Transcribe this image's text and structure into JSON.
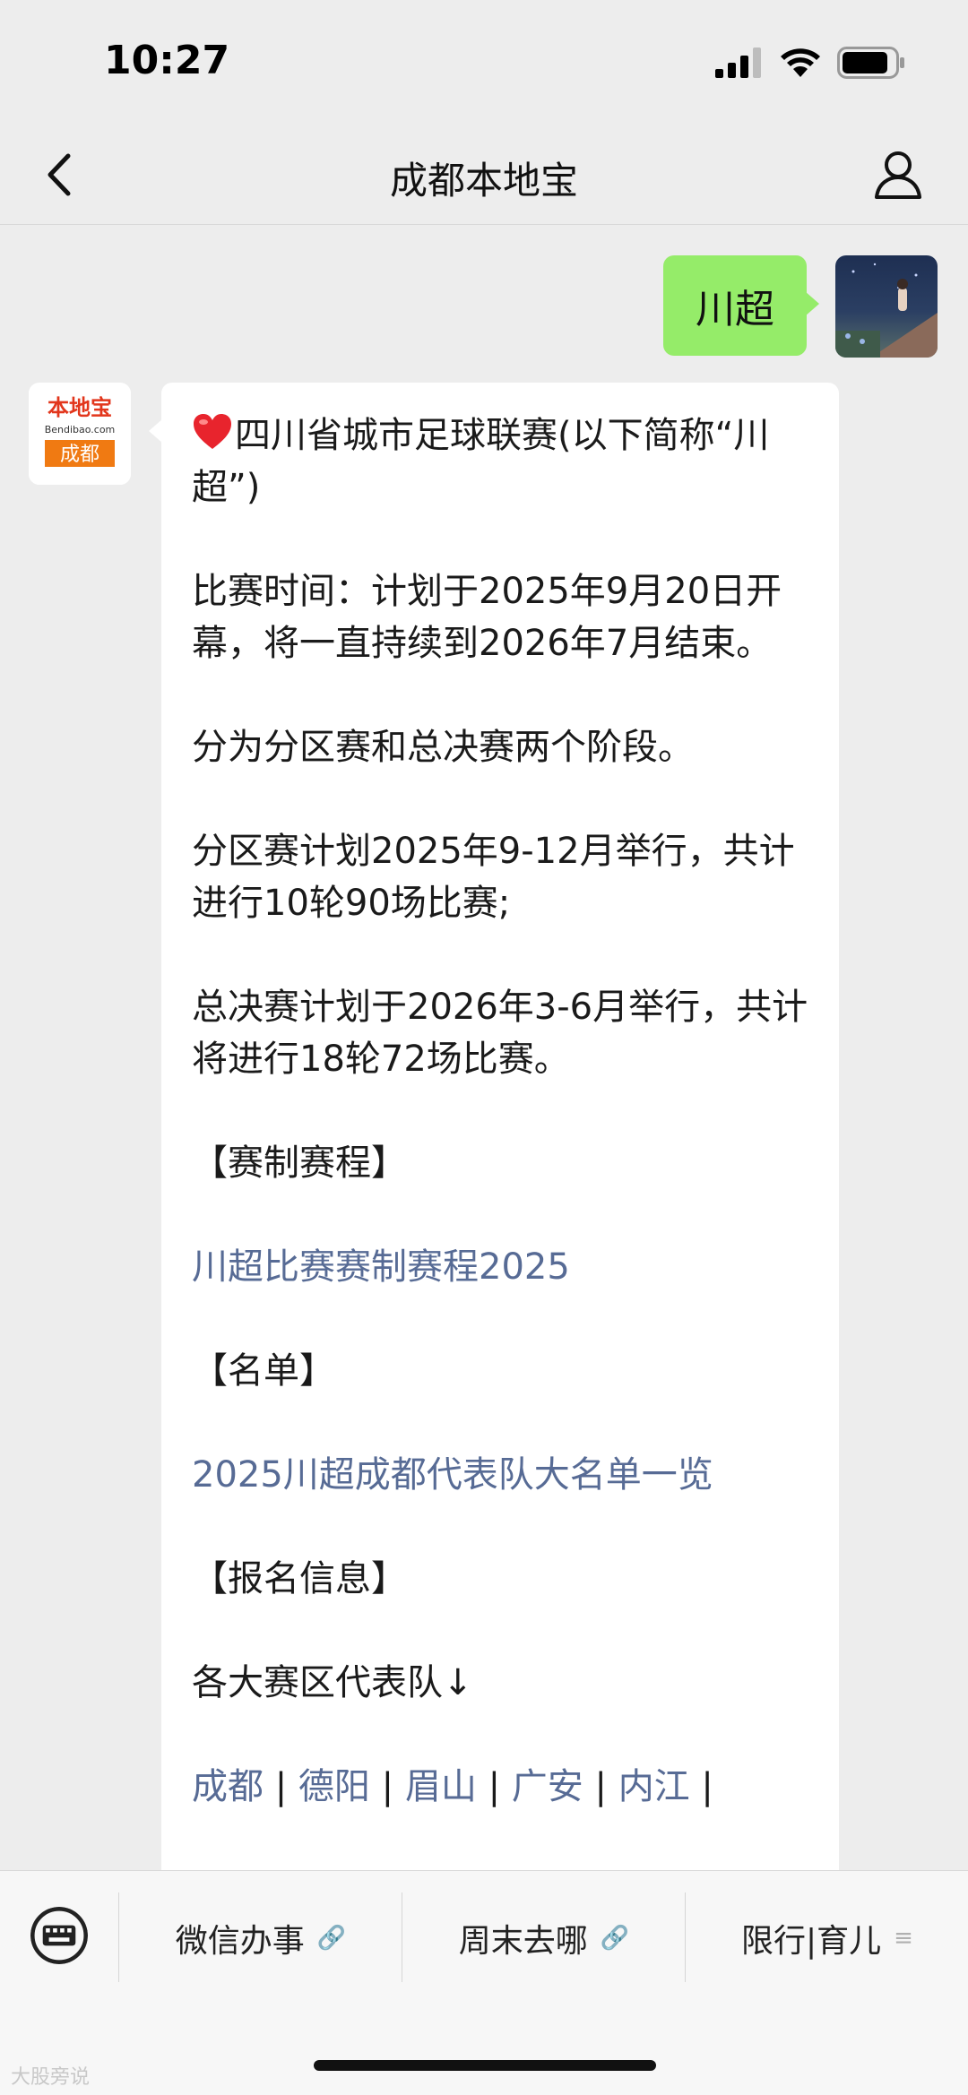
{
  "status": {
    "time": "10:27"
  },
  "nav": {
    "title": "成都本地宝"
  },
  "user_message": "川超",
  "bot": {
    "logo_top": "本地宝",
    "logo_site": "Bendibao.com",
    "logo_city": "成都",
    "intro": "四川省城市足球联赛(以下简称“川超”)",
    "time_text": "比赛时间：计划于2025年9月20日开幕，将一直持续到2026年7月结束。",
    "stages": "分为分区赛和总决赛两个阶段。",
    "division": "分区赛计划2025年9-12月举行，共计进行10轮90场比赛;",
    "finals": "总决赛计划于2026年3-6月举行，共计将进行18轮72场比赛。",
    "section_schedule": "【赛制赛程】",
    "link_schedule": "川超比赛赛制赛程2025",
    "section_roster": "【名单】",
    "link_roster": "2025川超成都代表队大名单一览",
    "section_signup": "【报名信息】",
    "teams_label": "各大赛区代表队↓",
    "cities": [
      "成都",
      "德阳",
      "眉山",
      "广安",
      "内江"
    ],
    "separator": "|"
  },
  "bottom_menu": {
    "items": [
      "微信办事",
      "周末去哪",
      "限行|育儿"
    ]
  },
  "watermark": "大股旁说"
}
